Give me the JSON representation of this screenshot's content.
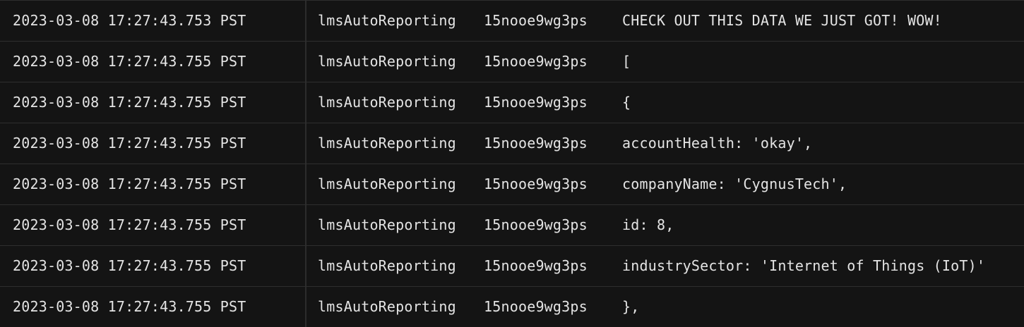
{
  "log": {
    "rows": [
      {
        "timestamp": "2023-03-08 17:27:43.753 PST",
        "service": "lmsAutoReporting",
        "instance": "15nooe9wg3ps",
        "message": "CHECK OUT THIS DATA WE JUST GOT! WOW!"
      },
      {
        "timestamp": "2023-03-08 17:27:43.755 PST",
        "service": "lmsAutoReporting",
        "instance": "15nooe9wg3ps",
        "message": "["
      },
      {
        "timestamp": "2023-03-08 17:27:43.755 PST",
        "service": "lmsAutoReporting",
        "instance": "15nooe9wg3ps",
        "message": "{"
      },
      {
        "timestamp": "2023-03-08 17:27:43.755 PST",
        "service": "lmsAutoReporting",
        "instance": "15nooe9wg3ps",
        "message": "accountHealth: 'okay',"
      },
      {
        "timestamp": "2023-03-08 17:27:43.755 PST",
        "service": "lmsAutoReporting",
        "instance": "15nooe9wg3ps",
        "message": "companyName: 'CygnusTech',"
      },
      {
        "timestamp": "2023-03-08 17:27:43.755 PST",
        "service": "lmsAutoReporting",
        "instance": "15nooe9wg3ps",
        "message": "id: 8,"
      },
      {
        "timestamp": "2023-03-08 17:27:43.755 PST",
        "service": "lmsAutoReporting",
        "instance": "15nooe9wg3ps",
        "message": "industrySector: 'Internet of Things (IoT)'"
      },
      {
        "timestamp": "2023-03-08 17:27:43.755 PST",
        "service": "lmsAutoReporting",
        "instance": "15nooe9wg3ps",
        "message": "},"
      }
    ]
  },
  "colors": {
    "background": "#141414",
    "text": "#e4e4e4",
    "row_border": "#2e2e2e",
    "column_divider": "#2c2c2c"
  }
}
